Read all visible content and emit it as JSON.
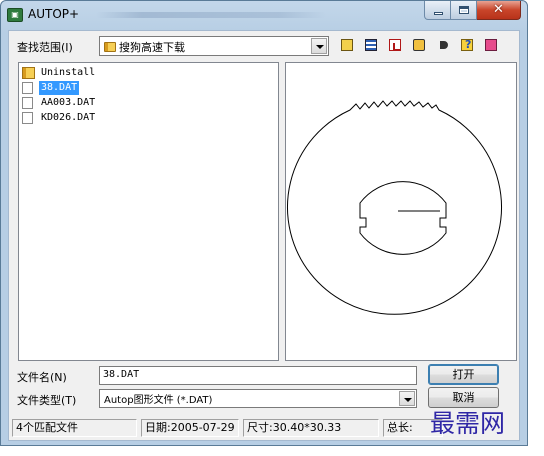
{
  "window": {
    "title": "AUTOP+"
  },
  "look_in": {
    "label": "查找范围(I)",
    "value": "搜狗高速下载"
  },
  "toolbar": {
    "icons": [
      "open-folder-icon",
      "details-view-icon",
      "chart-icon",
      "tool-icon",
      "hand-icon",
      "help-icon",
      "exit-icon"
    ]
  },
  "files": [
    {
      "name": "Uninstall",
      "type": "folder",
      "selected": false
    },
    {
      "name": "38.DAT",
      "type": "file",
      "selected": true
    },
    {
      "name": "AA003.DAT",
      "type": "file",
      "selected": false
    },
    {
      "name": "KD026.DAT",
      "type": "file",
      "selected": false
    }
  ],
  "filename": {
    "label": "文件名(N)",
    "value": "38.DAT"
  },
  "filetype": {
    "label": "文件类型(T)",
    "value": "Autop图形文件 (*.DAT)"
  },
  "buttons": {
    "open": "打开",
    "cancel": "取消"
  },
  "status": {
    "count": "4个匹配文件",
    "date": "日期:2005-07-29",
    "size": "尺寸:30.40*30.33",
    "total_prefix": "总长:"
  },
  "watermark": "最需网"
}
